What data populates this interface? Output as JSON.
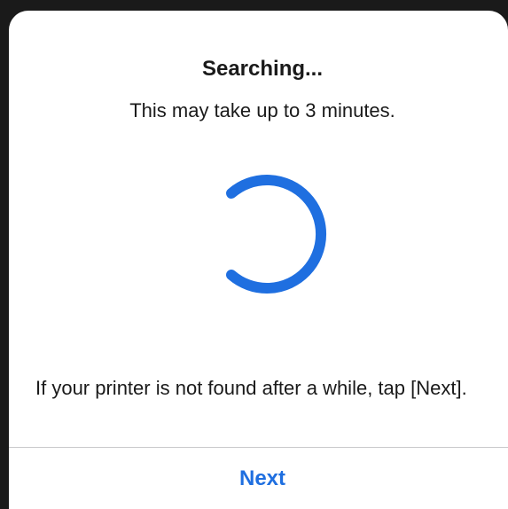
{
  "dialog": {
    "title": "Searching...",
    "subtitle": "This may take up to 3 minutes.",
    "hint": "If your printer is not found after a while, tap [Next].",
    "next_label": "Next"
  },
  "spinner": {
    "icon": "loading-spinner-icon",
    "color": "#1f6fe0"
  },
  "colors": {
    "accent": "#1f6fe0",
    "text": "#1a1a1a",
    "divider": "#c9c9cc",
    "backdrop": "#1a1a1a"
  }
}
